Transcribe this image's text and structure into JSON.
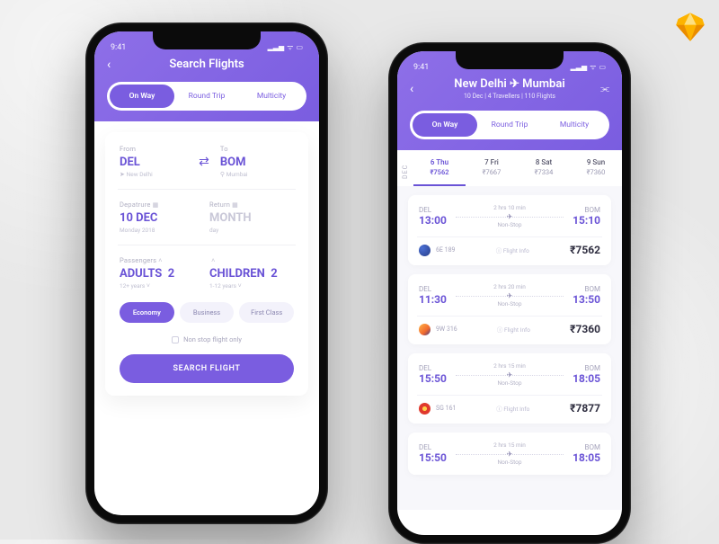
{
  "sketch_badge": "sketch-logo",
  "status_time": "9:41",
  "search": {
    "title": "Search Flights",
    "tabs": [
      "On Way",
      "Round Trip",
      "Multicity"
    ],
    "from": {
      "label": "From",
      "code": "DEL",
      "city": "New Delhi"
    },
    "to": {
      "label": "To",
      "code": "BOM",
      "city": "Mumbai"
    },
    "departure": {
      "label": "Depatrure",
      "value": "10 DEC",
      "sub": "Monday 2018"
    },
    "return": {
      "label": "Return",
      "value": "MONTH",
      "sub": "day"
    },
    "passengers": {
      "label": "Passengers",
      "adults": {
        "label": "ADULTS",
        "count": "2",
        "sub": "12+ years"
      },
      "children": {
        "label": "CHILDREN",
        "count": "2",
        "sub": "1-12 years"
      }
    },
    "classes": [
      "Economy",
      "Business",
      "First Class"
    ],
    "nonstop_label": "Non stop flight only",
    "submit": "SEARCH FLIGHT"
  },
  "results": {
    "route_from": "New Delhi",
    "route_to": "Mumbai",
    "subtitle": "10 Dec | 4 Travellers | 110 Flights",
    "tabs": [
      "On Way",
      "Round Trip",
      "Multicity"
    ],
    "month_label": "DEC",
    "dates": [
      {
        "day": "6 Thu",
        "price": "₹7562",
        "active": true
      },
      {
        "day": "7 Fri",
        "price": "₹7667"
      },
      {
        "day": "8 Sat",
        "price": "₹7334"
      },
      {
        "day": "9 Sun",
        "price": "₹7360"
      }
    ],
    "flights": [
      {
        "dep_code": "DEL",
        "dep_time": "13:00",
        "dur": "2 hrs 10 min",
        "stop": "Non-Stop",
        "arr_code": "BOM",
        "arr_time": "15:10",
        "airline_code": "6E 189",
        "price": "₹7562",
        "logo": "al-indigo"
      },
      {
        "dep_code": "DEL",
        "dep_time": "11:30",
        "dur": "2 hrs 20 min",
        "stop": "Non-Stop",
        "arr_code": "BOM",
        "arr_time": "13:50",
        "airline_code": "9W 316",
        "price": "₹7360",
        "logo": "al-jet"
      },
      {
        "dep_code": "DEL",
        "dep_time": "15:50",
        "dur": "2 hrs 15 min",
        "stop": "Non-Stop",
        "arr_code": "BOM",
        "arr_time": "18:05",
        "airline_code": "SG 161",
        "price": "₹7877",
        "logo": "al-spice"
      },
      {
        "dep_code": "DEL",
        "dep_time": "15:50",
        "dur": "2 hrs 15 min",
        "stop": "Non-Stop",
        "arr_code": "BOM",
        "arr_time": "18:05",
        "airline_code": "",
        "price": "",
        "logo": ""
      }
    ],
    "flight_info_label": "Flight Info"
  }
}
